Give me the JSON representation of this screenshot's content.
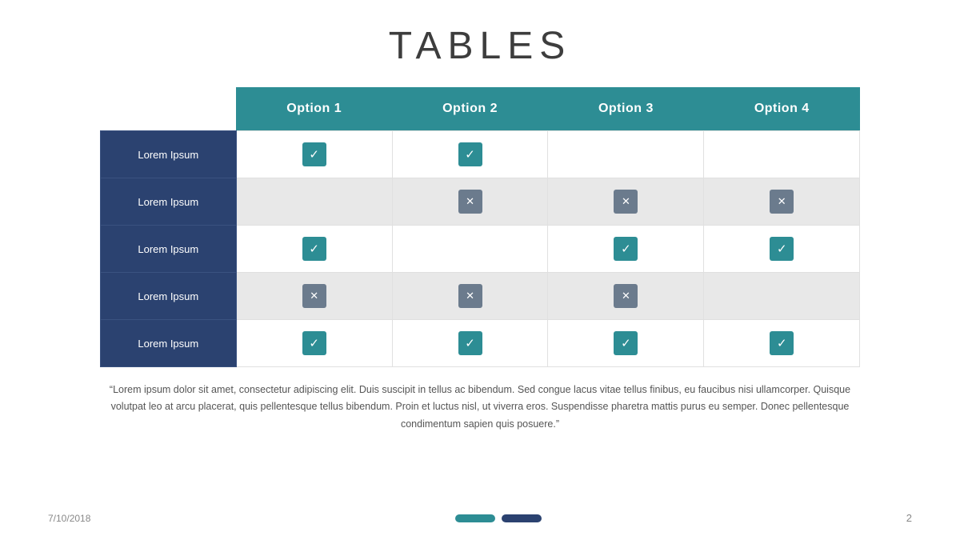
{
  "title": "TABLES",
  "table": {
    "headers": [
      "",
      "Option 1",
      "Option 2",
      "Option 3",
      "Option 4"
    ],
    "rows": [
      {
        "label": "Lorem Ipsum",
        "cells": [
          "check",
          "check",
          "",
          ""
        ]
      },
      {
        "label": "Lorem Ipsum",
        "cells": [
          "",
          "cross",
          "cross",
          "cross"
        ]
      },
      {
        "label": "Lorem Ipsum",
        "cells": [
          "check",
          "",
          "check",
          "check"
        ]
      },
      {
        "label": "Lorem Ipsum",
        "cells": [
          "cross",
          "cross",
          "cross",
          ""
        ]
      },
      {
        "label": "Lorem Ipsum",
        "cells": [
          "check",
          "check",
          "check",
          "check"
        ]
      }
    ]
  },
  "quote": "“Lorem ipsum dolor sit amet, consectetur adipiscing elit. Duis suscipit in tellus ac bibendum. Sed congue lacus vitae tellus finibus, eu faucibus nisi ullamcorper. Quisque volutpat leo at arcu placerat, quis pellentesque tellus bibendum. Proin et luctus nisl, ut viverra eros. Suspendisse pharetra mattis purus eu semper. Donec pellentesque condimentum sapien quis posuere.”",
  "footer": {
    "date": "7/10/2018",
    "page": "2"
  }
}
